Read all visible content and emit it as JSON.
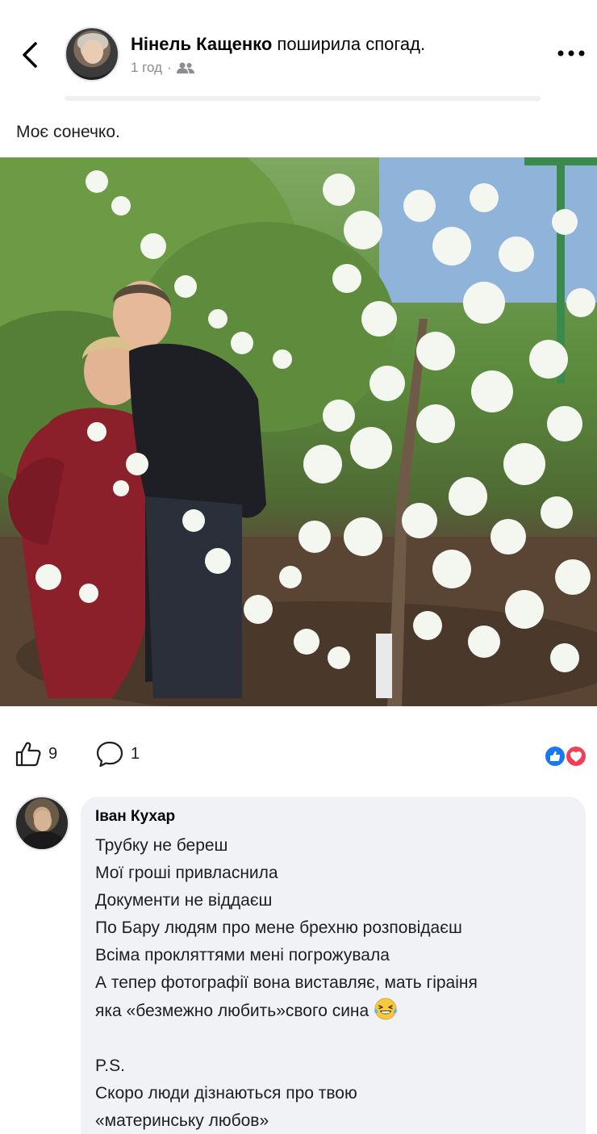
{
  "header": {
    "author_name": "Нінель Кащенко",
    "action_text": " поширила спогад.",
    "time": "1 год",
    "dot": "·",
    "audience_icon": "friends-icon",
    "back_icon": "chevron-left-icon",
    "more_icon": "more-dots-icon"
  },
  "post": {
    "text": "Моє сонечко.",
    "photo_icon": "post-photo"
  },
  "actions": {
    "like_count": "9",
    "comment_count": "1",
    "like_icon": "thumbs-up-icon",
    "comment_icon": "comment-bubble-icon",
    "reactions": [
      "like",
      "love"
    ]
  },
  "comment": {
    "author": "Іван Кухар",
    "lines": [
      "Трубку не береш",
      "Мої гроші привласнила",
      "Документи не віддаєш",
      "По Бару людям про мене брехню розповідаєш",
      "Всіма прокляттями мені погрожувала",
      "А тепер фотографії вона виставляє, мать гіраіня",
      "яка «безмежно любить»свого сина"
    ],
    "ps": "P.S.",
    "ps_lines": [
      "Скоро люди дізнаються про твою",
      "«материнську любов»"
    ],
    "emoji": "laughing-tears-emoji"
  },
  "colors": {
    "like_blue": "#1877f2",
    "love_red": "#f33e58",
    "bubble_gray": "#f0f2f5",
    "meta_gray": "#8a8d91"
  }
}
